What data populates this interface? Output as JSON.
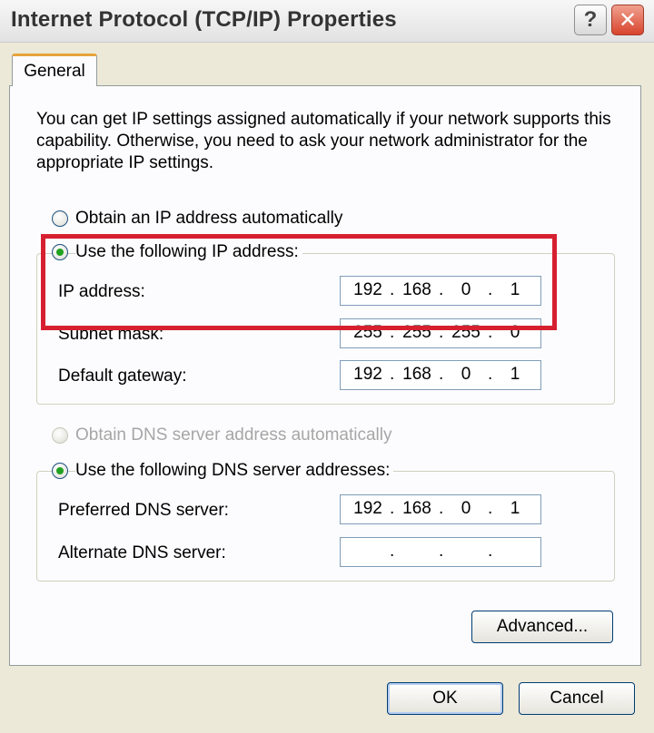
{
  "window": {
    "title": "Internet Protocol (TCP/IP) Properties",
    "help_label": "?",
    "close_label": "✕"
  },
  "tabs": [
    {
      "label": "General",
      "active": true
    }
  ],
  "intro_text": "You can get IP settings assigned automatically if your network supports this capability. Otherwise, you need to ask your network administrator for the appropriate IP settings.",
  "ip_mode": {
    "auto_label": "Obtain an IP address automatically",
    "manual_label": "Use the following IP address:",
    "selected": "manual"
  },
  "ip_fields": {
    "ip_address": {
      "label": "IP address:",
      "octets": [
        "192",
        "168",
        "0",
        "1"
      ]
    },
    "subnet_mask": {
      "label": "Subnet mask:",
      "octets": [
        "255",
        "255",
        "255",
        "0"
      ]
    },
    "default_gateway": {
      "label": "Default gateway:",
      "octets": [
        "192",
        "168",
        "0",
        "1"
      ]
    }
  },
  "dns_mode": {
    "auto_label": "Obtain DNS server address automatically",
    "manual_label": "Use the following DNS server addresses:",
    "selected": "manual",
    "auto_disabled": true
  },
  "dns_fields": {
    "preferred": {
      "label": "Preferred DNS server:",
      "octets": [
        "192",
        "168",
        "0",
        "1"
      ]
    },
    "alternate": {
      "label": "Alternate DNS server:",
      "octets": [
        "",
        "",
        "",
        ""
      ]
    }
  },
  "buttons": {
    "advanced": "Advanced...",
    "ok": "OK",
    "cancel": "Cancel"
  },
  "annotation": {
    "color": "#d62030"
  }
}
